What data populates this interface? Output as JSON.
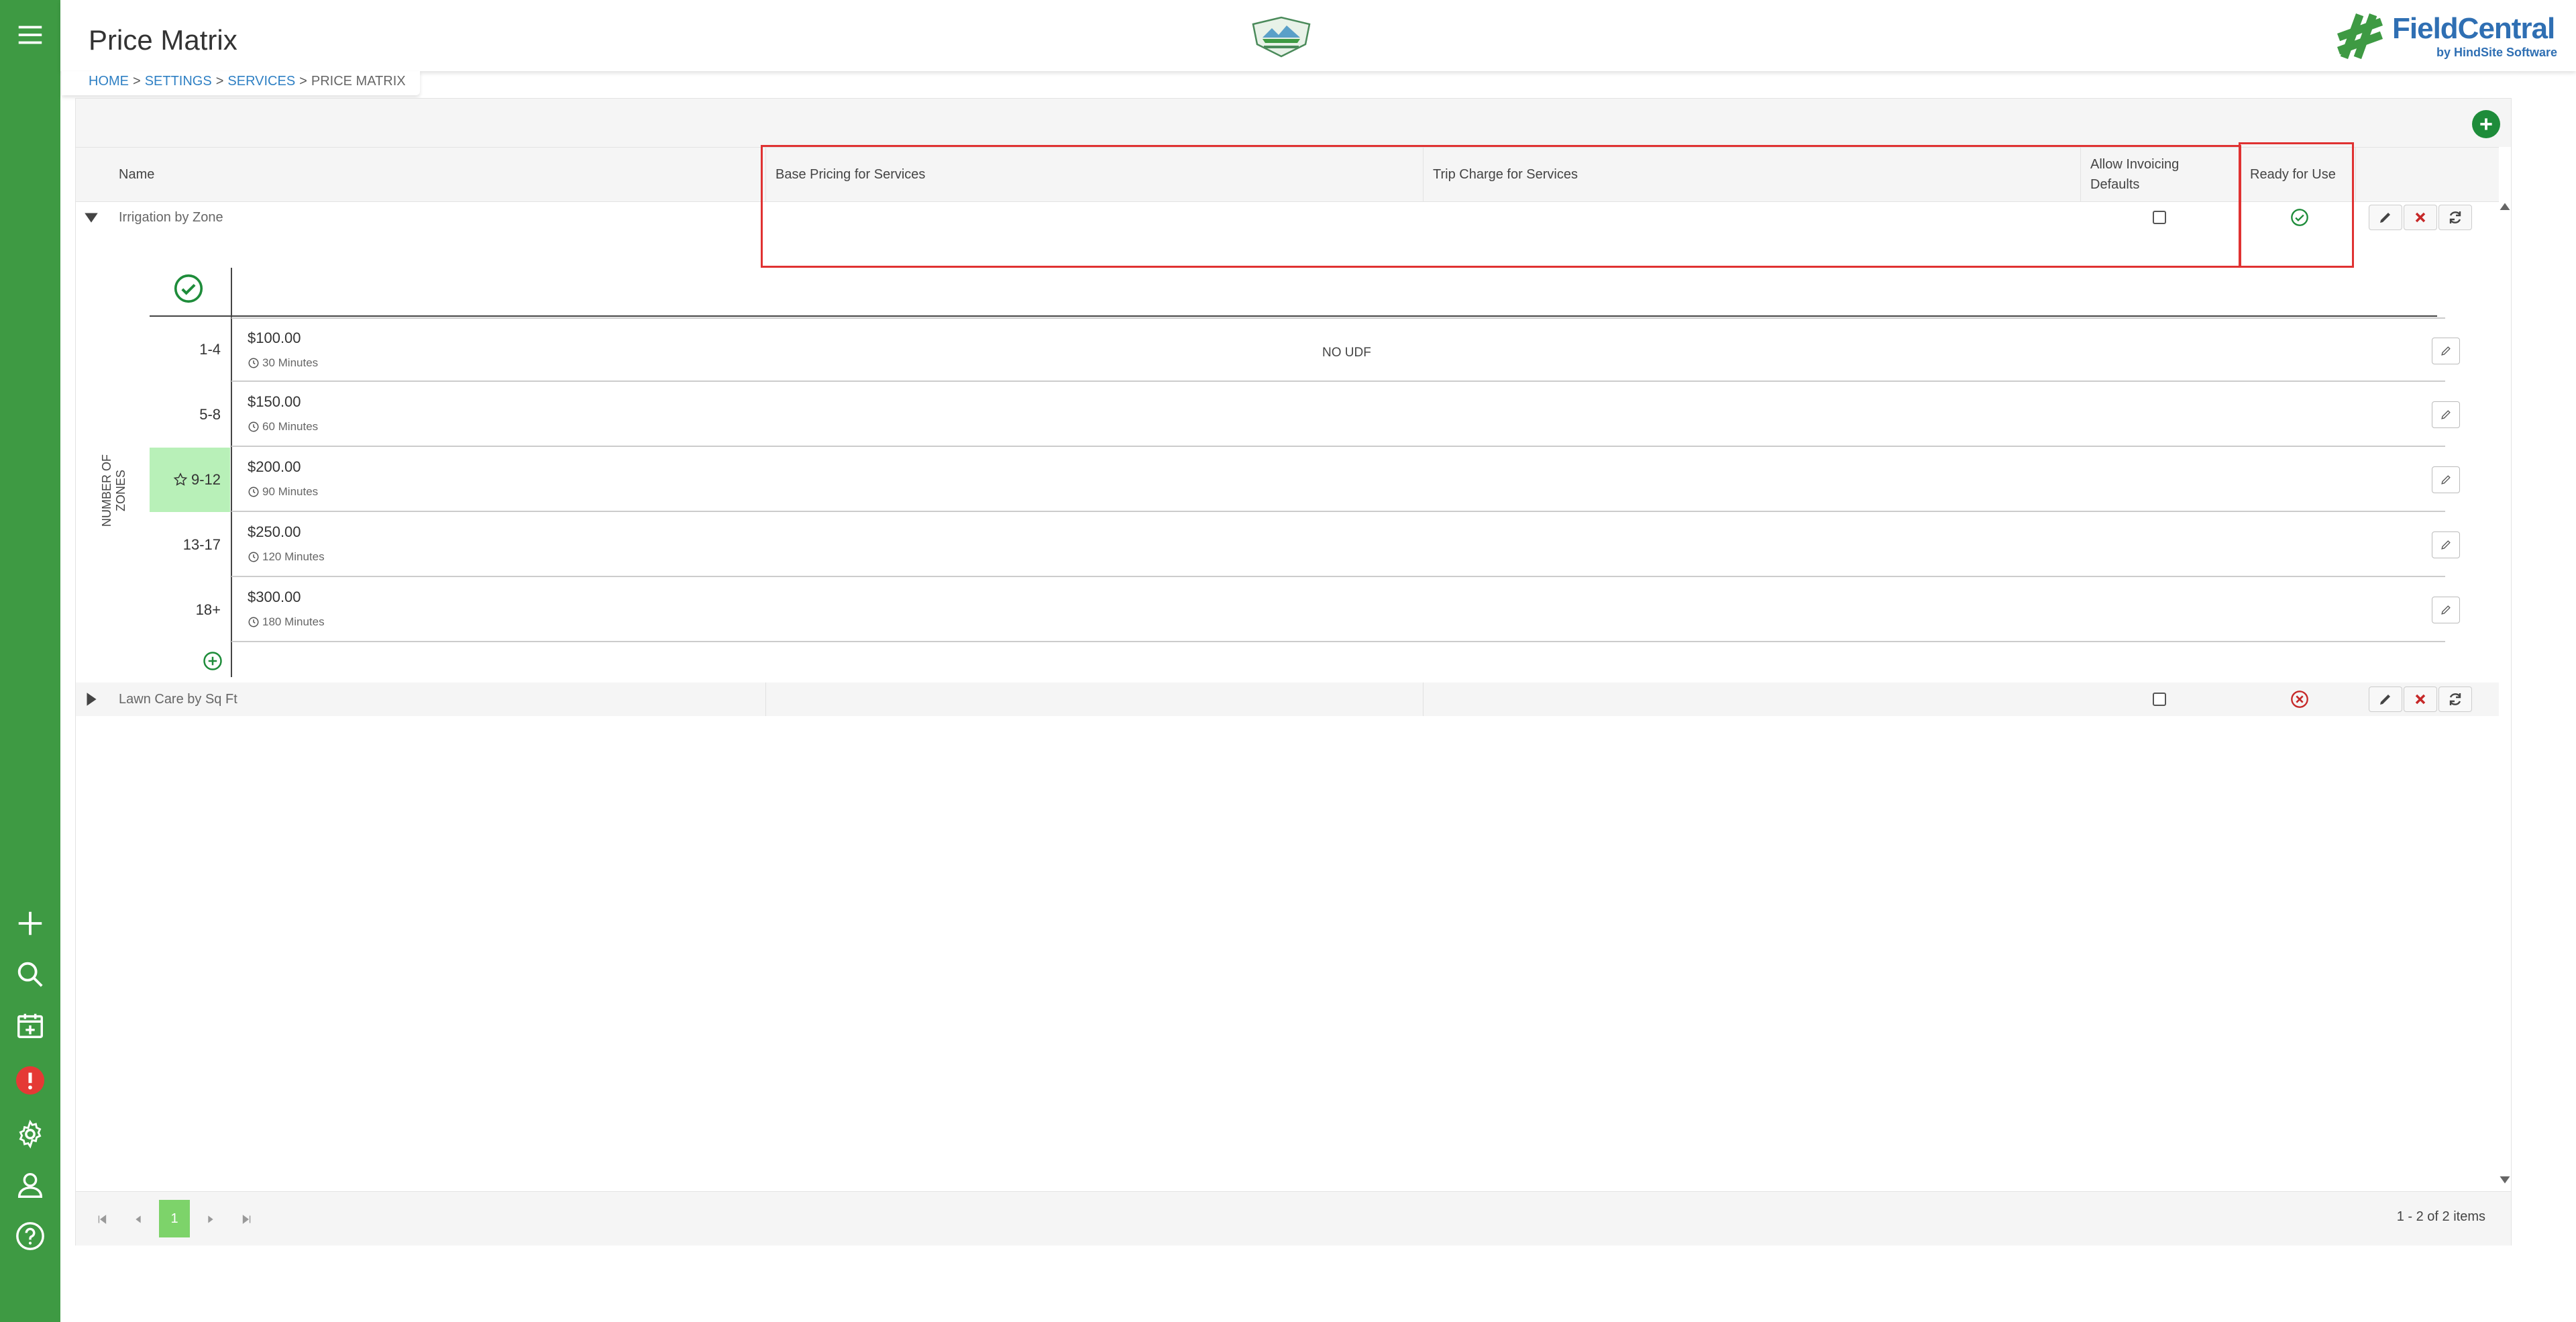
{
  "app": {
    "page_title": "Price Matrix",
    "brand": {
      "name": "FieldCentral",
      "sub": "by HindSite Software"
    }
  },
  "breadcrumb": {
    "home": "HOME",
    "settings": "SETTINGS",
    "services": "SERVICES",
    "current": "PRICE MATRIX",
    "sep": ">"
  },
  "grid": {
    "columns": {
      "name": "Name",
      "base_pricing": "Base Pricing for Services",
      "trip_charge": "Trip Charge for Services",
      "allow_invoicing": "Allow Invoicing Defaults",
      "ready": "Ready for Use"
    },
    "rows": [
      {
        "name": "Irrigation by Zone",
        "allow_invoicing": false,
        "ready": true,
        "expanded": true
      },
      {
        "name": "Lawn Care by Sq Ft",
        "allow_invoicing": false,
        "ready": false,
        "expanded": false
      }
    ],
    "no_udf": "NO UDF"
  },
  "matrix": {
    "axis_label": "NUMBER OF ZONES",
    "rows": [
      {
        "range": "1-4",
        "price": "$100.00",
        "duration": "30 Minutes",
        "default": false
      },
      {
        "range": "5-8",
        "price": "$150.00",
        "duration": "60 Minutes",
        "default": false
      },
      {
        "range": "9-12",
        "price": "$200.00",
        "duration": "90 Minutes",
        "default": true
      },
      {
        "range": "13-17",
        "price": "$250.00",
        "duration": "120 Minutes",
        "default": false
      },
      {
        "range": "18+",
        "price": "$300.00",
        "duration": "180 Minutes",
        "default": false
      }
    ]
  },
  "pager": {
    "current_page": "1",
    "info": "1 - 2 of 2 items"
  },
  "colors": {
    "sidebar": "#3e9a43",
    "accent_green": "#1e8c3a",
    "error_red": "#e03232",
    "link_blue": "#2f80c4",
    "selected_cell": "#b8f0b8"
  }
}
